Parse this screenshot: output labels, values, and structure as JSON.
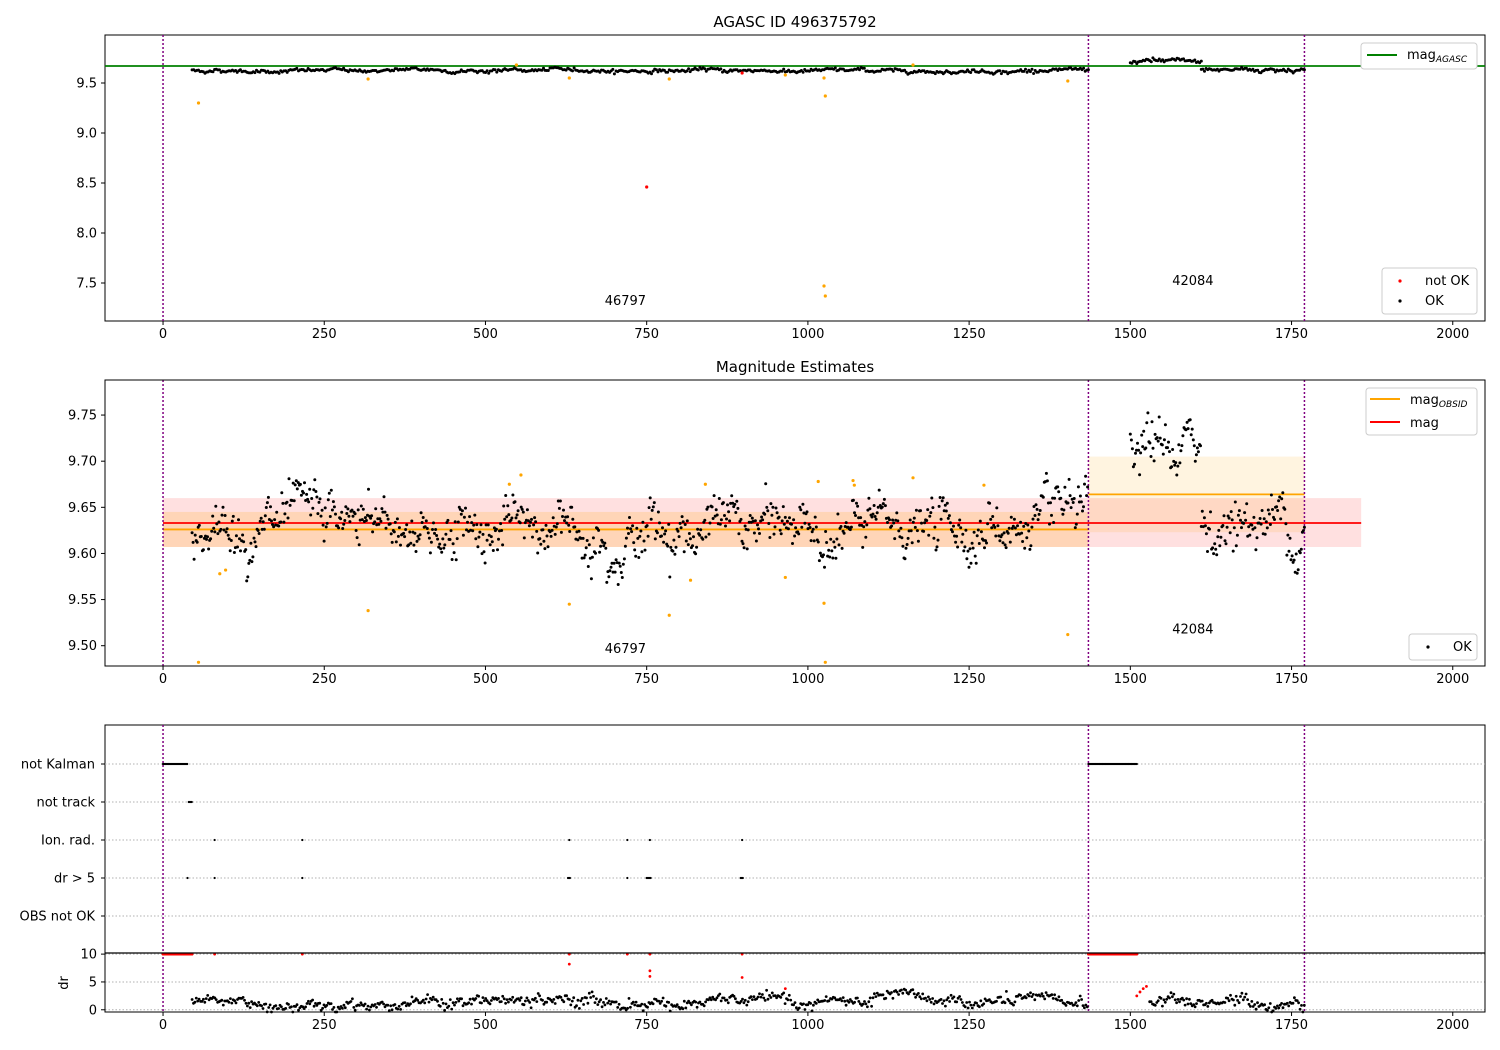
{
  "chart_data": [
    {
      "type": "scatter",
      "title": "AGASC ID 496375792",
      "xlabel": "",
      "ylabel": "",
      "xlim": [
        -90,
        2050
      ],
      "ylim": [
        7.12,
        9.98
      ],
      "x_ticks": [
        0,
        250,
        500,
        750,
        1000,
        1250,
        1500,
        1750,
        2000
      ],
      "y_ticks": [
        7.5,
        8.0,
        8.5,
        9.0,
        9.5
      ],
      "x_tick_labels": [
        "0",
        "250",
        "500",
        "750",
        "1000",
        "1250",
        "1500",
        "1750",
        "2000"
      ],
      "y_tick_labels": [
        "7.5",
        "8.0",
        "8.5",
        "9.0",
        "9.5"
      ],
      "grid": false,
      "vlines": [
        0,
        1435,
        1770
      ],
      "obsid_labels": [
        {
          "x": 717,
          "y": 7.28,
          "text": "46797"
        },
        {
          "x": 1597,
          "y": 7.48,
          "text": "42084"
        }
      ],
      "legend_lines": {
        "placement": "top-right",
        "entries": [
          "mag_AGASC"
        ]
      },
      "legend_points": {
        "placement": "bottom-right",
        "entries": [
          "not OK",
          "OK"
        ]
      },
      "lines": [
        {
          "name": "mag_AGASC",
          "color": "#008000",
          "x": [
            -90,
            2050
          ],
          "y": [
            9.67,
            9.67
          ]
        }
      ],
      "series": [
        {
          "name": "OK",
          "color": "#000000",
          "segments": [
            {
              "x0": 45,
              "x1": 1435,
              "level": 9.625,
              "noise": 0.012
            },
            {
              "x0": 1500,
              "x1": 1610,
              "level": 9.71,
              "noise": 0.015
            },
            {
              "x0": 1610,
              "x1": 1770,
              "level": 9.635,
              "noise": 0.015
            }
          ]
        },
        {
          "name": "not OK",
          "color": "#ff0000",
          "x": [
            750,
            898
          ],
          "y": [
            8.46,
            9.6
          ]
        },
        {
          "name": "rejected",
          "color": "#ffa500",
          "x": [
            55,
            318,
            548,
            630,
            785,
            965,
            1025,
            1027,
            1025,
            1027,
            1403,
            1163
          ],
          "y": [
            9.3,
            9.54,
            9.68,
            9.55,
            9.54,
            9.58,
            9.55,
            9.37,
            7.47,
            7.37,
            9.52,
            9.68
          ]
        }
      ]
    },
    {
      "type": "scatter",
      "title": "Magnitude Estimates",
      "xlabel": "",
      "ylabel": "",
      "xlim": [
        -90,
        2050
      ],
      "ylim": [
        9.478,
        9.788
      ],
      "x_ticks": [
        0,
        250,
        500,
        750,
        1000,
        1250,
        1500,
        1750,
        2000
      ],
      "y_ticks": [
        9.5,
        9.55,
        9.6,
        9.65,
        9.7,
        9.75
      ],
      "x_tick_labels": [
        "0",
        "250",
        "500",
        "750",
        "1000",
        "1250",
        "1500",
        "1750",
        "2000"
      ],
      "y_tick_labels": [
        "9.50",
        "9.55",
        "9.60",
        "9.65",
        "9.70",
        "9.75"
      ],
      "grid": false,
      "vlines": [
        0,
        1435,
        1770
      ],
      "obsid_labels": [
        {
          "x": 717,
          "y": 9.492,
          "text": "46797"
        },
        {
          "x": 1597,
          "y": 9.513,
          "text": "42084"
        }
      ],
      "legend_lines": {
        "placement": "top-right",
        "entries": [
          "mag_OBSID",
          "mag"
        ]
      },
      "legend_points": {
        "placement": "bottom-right",
        "entries": [
          "OK"
        ]
      },
      "lines": [
        {
          "name": "mag_OBSID",
          "color": "#ffa500",
          "x": [
            0,
            1435
          ],
          "y": [
            9.626,
            9.626
          ]
        },
        {
          "name": "mag_OBSID",
          "color": "#ffa500",
          "x": [
            1435,
            1770
          ],
          "y": [
            9.664,
            9.664
          ]
        },
        {
          "name": "mag",
          "color": "#ff0000",
          "x": [
            0,
            1858
          ],
          "y": [
            9.633,
            9.633
          ]
        }
      ],
      "bands": [
        {
          "color": "#ff0000",
          "opacity": 0.12,
          "x": [
            0,
            1858
          ],
          "y": [
            9.607,
            9.66
          ]
        },
        {
          "color": "#ffa500",
          "opacity": 0.18,
          "x": [
            0,
            1435
          ],
          "y": [
            9.607,
            9.645
          ]
        },
        {
          "color": "#ffa500",
          "opacity": 0.12,
          "x": [
            1435,
            1770
          ],
          "y": [
            9.623,
            9.705
          ]
        }
      ],
      "series": [
        {
          "name": "OK",
          "color": "#000000",
          "segments": [
            {
              "x0": 45,
              "x1": 1435,
              "level": 9.627,
              "noise": 0.016
            },
            {
              "x0": 1500,
              "x1": 1610,
              "level": 9.71,
              "noise": 0.018
            },
            {
              "x0": 1610,
              "x1": 1770,
              "level": 9.635,
              "noise": 0.018
            }
          ]
        },
        {
          "name": "rejected",
          "color": "#ffa500",
          "x": [
            55,
            88,
            97,
            318,
            537,
            555,
            630,
            785,
            818,
            841,
            965,
            1016,
            1025,
            1027,
            1070,
            1072,
            1163,
            1273,
            1403
          ],
          "y": [
            9.482,
            9.578,
            9.582,
            9.538,
            9.675,
            9.685,
            9.545,
            9.533,
            9.571,
            9.675,
            9.574,
            9.678,
            9.546,
            9.482,
            9.679,
            9.674,
            9.682,
            9.674,
            9.512
          ]
        }
      ]
    },
    {
      "type": "scatter",
      "title": "",
      "xlabel": "",
      "ylabel": "",
      "xlim": [
        -90,
        2050
      ],
      "categories": [
        "not Kalman",
        "not track",
        "Ion. rad.",
        "dr > 5",
        "OBS not OK"
      ],
      "x_ticks": [],
      "grid": true,
      "vlines": [
        0,
        1435,
        1770
      ],
      "series": [
        {
          "name": "not Kalman",
          "color": "#000000",
          "ranges": [
            [
              0,
              38
            ],
            [
              1435,
              1510
            ]
          ],
          "x": []
        },
        {
          "name": "not track",
          "color": "#000000",
          "ranges": [
            [
              40,
              45
            ]
          ],
          "x": []
        },
        {
          "name": "Ion. rad.",
          "color": "#000000",
          "ranges": [],
          "x": [
            80,
            216,
            630,
            720,
            755,
            898
          ]
        },
        {
          "name": "dr > 5",
          "color": "#000000",
          "ranges": [
            [
              628,
              632
            ],
            [
              750,
              756
            ],
            [
              896,
              900
            ]
          ],
          "x": [
            38,
            80,
            216,
            720
          ]
        },
        {
          "name": "OBS not OK",
          "color": "#000000",
          "ranges": [],
          "x": []
        }
      ]
    },
    {
      "type": "scatter",
      "title": "",
      "xlabel": "",
      "ylabel": "dr",
      "xlim": [
        -90,
        2050
      ],
      "ylim": [
        -0.4,
        10.2
      ],
      "x_ticks": [
        0,
        250,
        500,
        750,
        1000,
        1250,
        1500,
        1750,
        2000
      ],
      "y_ticks": [
        0,
        5,
        10
      ],
      "x_tick_labels": [
        "0",
        "250",
        "500",
        "750",
        "1000",
        "1250",
        "1500",
        "1750",
        "2000"
      ],
      "y_tick_labels": [
        "0",
        "5",
        "10"
      ],
      "grid": true,
      "vlines": [
        0,
        1435,
        1770
      ],
      "series": [
        {
          "name": "OK",
          "color": "#000000",
          "segments": [
            {
              "x0": 45,
              "x1": 1435,
              "level": 1.3,
              "noise": 0.7
            },
            {
              "x0": 1530,
              "x1": 1770,
              "level": 1.3,
              "noise": 0.7
            }
          ]
        },
        {
          "name": "not OK",
          "color": "#ff0000",
          "ranges": [
            [
              0,
              45
            ],
            [
              1435,
              1510
            ]
          ],
          "x": [
            80,
            216,
            630,
            630,
            720,
            755,
            755,
            755,
            898,
            898,
            965,
            1510,
            1515,
            1520,
            1525
          ],
          "y": [
            10,
            10,
            10,
            8.2,
            10,
            10,
            7,
            6,
            10,
            5.8,
            3.8,
            2.5,
            3.2,
            3.8,
            4.2
          ]
        }
      ]
    }
  ],
  "legend_labels": {
    "mag_agasc_main": "mag",
    "mag_agasc_sub": "AGASC",
    "mag_obsid_main": "mag",
    "mag_obsid_sub": "OBSID",
    "mag": "mag",
    "not_ok": "not OK",
    "ok": "OK"
  }
}
